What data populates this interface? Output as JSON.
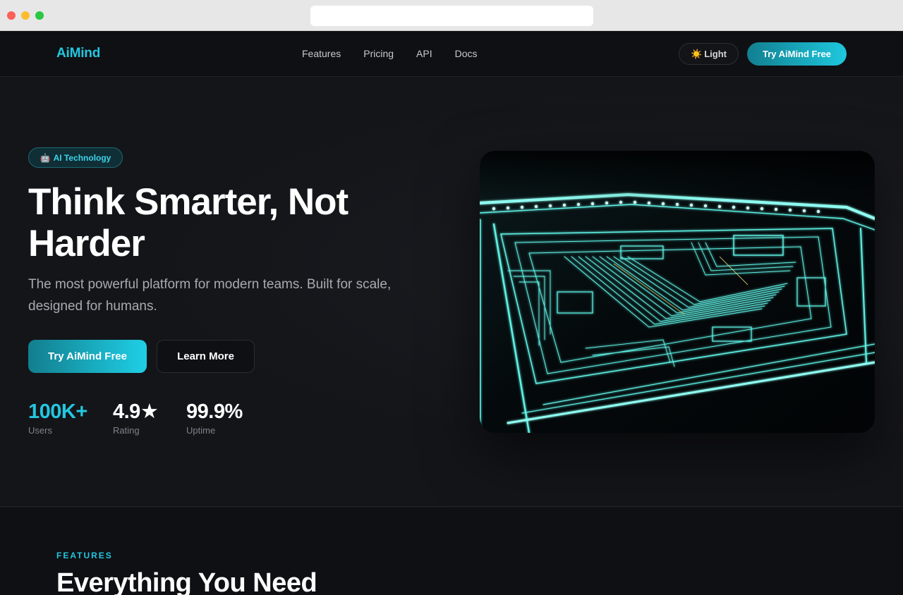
{
  "browser": {
    "url": ""
  },
  "nav": {
    "logo": "AiMind",
    "links": [
      "Features",
      "Pricing",
      "API",
      "Docs"
    ],
    "theme_toggle": {
      "icon": "sun-icon",
      "label": "Light"
    },
    "cta": "Try AiMind Free"
  },
  "hero": {
    "badge": {
      "icon": "robot-icon",
      "label": "AI Technology"
    },
    "title": "Think Smarter, Not Harder",
    "subtitle": "The most powerful platform for modern teams. Built for scale, designed for humans.",
    "primary_button": "Try AiMind Free",
    "secondary_button": "Learn More",
    "stats": [
      {
        "value": "100K+",
        "label": "Users"
      },
      {
        "value": "4.9★",
        "label": "Rating"
      },
      {
        "value": "99.9%",
        "label": "Uptime"
      }
    ],
    "image": {
      "icon": "circuit-board-image"
    }
  },
  "features": {
    "eyebrow": "FEATURES",
    "title": "Everything You Need"
  },
  "colors": {
    "accent": "#22c7e0",
    "background": "#141519",
    "nav_background": "#0f1013"
  }
}
